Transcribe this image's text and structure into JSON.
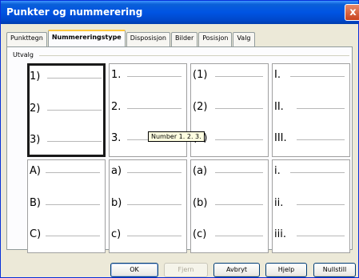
{
  "window": {
    "title": "Punkter og nummerering",
    "close_symbol": "x"
  },
  "tabs": [
    {
      "label": "Punkttegn",
      "active": false
    },
    {
      "label": "Nummereringstype",
      "active": true
    },
    {
      "label": "Disposisjon",
      "active": false
    },
    {
      "label": "Bilder",
      "active": false
    },
    {
      "label": "Posisjon",
      "active": false
    },
    {
      "label": "Valg",
      "active": false
    }
  ],
  "selection_group": {
    "label": "Utvalg"
  },
  "styles": [
    {
      "items": [
        "1)",
        "2)",
        "3)"
      ],
      "selected": true
    },
    {
      "items": [
        "1.",
        "2.",
        "3."
      ],
      "selected": false
    },
    {
      "items": [
        "(1)",
        "(2)",
        "(3)"
      ],
      "selected": false
    },
    {
      "items": [
        "I.",
        "II.",
        "III."
      ],
      "selected": false
    },
    {
      "items": [
        "A)",
        "B)",
        "C)"
      ],
      "selected": false
    },
    {
      "items": [
        "a)",
        "b)",
        "c)"
      ],
      "selected": false
    },
    {
      "items": [
        "(a)",
        "(b)",
        "(c)"
      ],
      "selected": false
    },
    {
      "items": [
        "i.",
        "ii.",
        "iii."
      ],
      "selected": false
    }
  ],
  "tooltip": {
    "text": "Number 1. 2. 3."
  },
  "buttons": {
    "ok": "OK",
    "remove": "Fjern",
    "cancel": "Avbryt",
    "help": "Hjelp",
    "reset": "Nullstill"
  }
}
